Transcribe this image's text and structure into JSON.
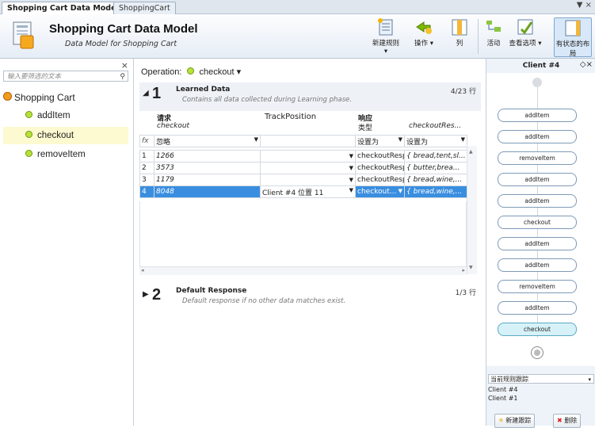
{
  "tabs": {
    "active": "Shopping Cart Data Model",
    "inactive": "ShoppingCart",
    "menu": "▼ ×"
  },
  "header": {
    "title": "Shopping Cart Data Model",
    "subtitle": "Data Model for Shopping Cart",
    "toolbar": {
      "new_rule": "新建规则 ▾",
      "action": "操作 ▾",
      "columns": "列",
      "activity": "活动",
      "view_options": "查看选项 ▾",
      "state_layout": "有状态的布局"
    }
  },
  "left": {
    "close": "×",
    "filter_placeholder": "输入要筛选的文本",
    "root": "Shopping Cart",
    "items": [
      "addItem",
      "checkout",
      "removeItem"
    ]
  },
  "main": {
    "operation_label": "Operation:",
    "operation_value": "checkout ▾",
    "learned": {
      "num": "1",
      "title": "Learned Data",
      "desc": "Contains all data collected during Learning phase.",
      "count": "4/23 行"
    },
    "default": {
      "num": "2",
      "title": "Default Response",
      "desc": "Default response if no other data matches exist.",
      "count": "1/3 行"
    },
    "grid": {
      "col_request": "请求",
      "col_request_sub": "checkout",
      "col_track": "TrackPosition",
      "col_response": "响应",
      "col_response_type": "类型",
      "col_response_sub": "checkoutRes...",
      "fx": "fx",
      "ignore": "忽略",
      "set1": "设置为",
      "set2": "设置为",
      "rows": [
        {
          "n": "1",
          "req": "1266",
          "track": "",
          "type": "checkoutRespoi",
          "data": "{ bread,tent,sl..."
        },
        {
          "n": "2",
          "req": "3573",
          "track": "",
          "type": "checkoutRespoi",
          "data": "{ butter,brea..."
        },
        {
          "n": "3",
          "req": "1179",
          "track": "",
          "type": "checkoutRespoi",
          "data": "{ bread,wine,..."
        },
        {
          "n": "4",
          "req": "8048",
          "track": "Client #4 位置 11",
          "type": "checkout...",
          "data": "{ bread,wine,..."
        }
      ]
    }
  },
  "right": {
    "title": "Client #4",
    "controls": "◇×",
    "nodes": [
      "addItem",
      "addItem",
      "removeItem",
      "addItem",
      "addItem",
      "checkout",
      "addItem",
      "addItem",
      "removeItem",
      "addItem",
      "checkout"
    ],
    "dropdown": "当前规则跟踪",
    "list": [
      "Client #4",
      "Client #1"
    ],
    "new_trace": "新建跟踪",
    "delete": "删除"
  }
}
